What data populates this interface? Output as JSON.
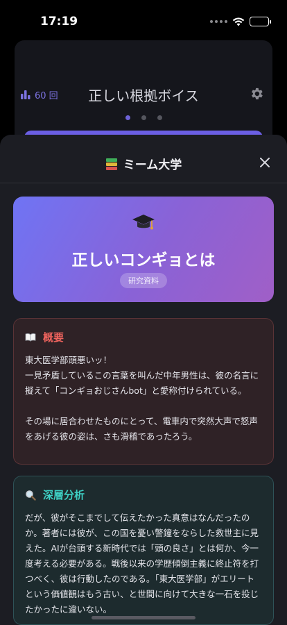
{
  "status": {
    "time": "17:19"
  },
  "background_card": {
    "count_label": "60 回",
    "title": "正しい根拠ボイス",
    "page_count": 3,
    "active_page": 1
  },
  "sheet": {
    "title": "ミーム大学",
    "title_icon": "books-icon",
    "close_icon": "close-icon",
    "hero": {
      "icon": "graduation-cap-icon",
      "title": "正しいコンギョとは",
      "tag": "研究資料"
    },
    "overview": {
      "icon": "open-book-icon",
      "title": "概要",
      "body": "東大医学部頭悪いッ！\n一見矛盾しているこの言葉を叫んだ中年男性は、彼の名言に擬えて「コンギョおじさんbot」と愛称付けられている。\n\nその場に居合わせたものにとって、電車内で突然大声で怒声をあげる彼の姿は、さも滑稽であったろう。"
    },
    "deep_analysis": {
      "icon": "magnifier-icon",
      "title": "深層分析",
      "body": "だが、彼がそこまでして伝えたかった真意はなんだったのか。著者には彼が、この国を憂い警鐘をならした救世主に見えた。AIが台頭する新時代では「頭の良さ」とは何か、今一度考える必要がある。戦後以来の学歴傾倒主義に終止符を打つべく、彼は行動したのである。「東大医学部」がエリートという価値観はもう古い、と世間に向けて大きな一石を投じたかったに違いない。"
    }
  },
  "colors": {
    "accent": "#6e63d8",
    "hero_gradient_start": "#6f74f4",
    "hero_gradient_end": "#a05fc7",
    "overview_title": "#f0645e",
    "deep_title": "#3ecfc4"
  }
}
